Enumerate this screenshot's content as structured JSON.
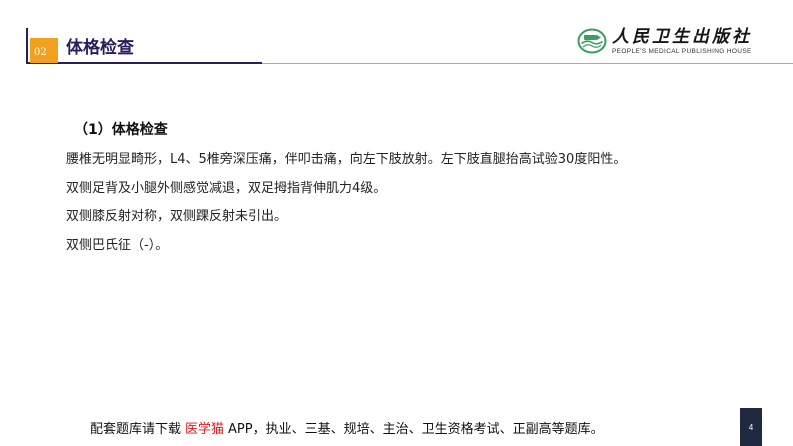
{
  "header": {
    "section_number": "02",
    "title": "体格检查"
  },
  "logo": {
    "emblem_icon": "publisher-emblem-icon",
    "name_cn": "人民卫生出版社",
    "name_en": "PEOPLE'S MEDICAL PUBLISHING HOUSE"
  },
  "content": {
    "heading": "（1）体格检查",
    "lines": [
      "腰椎无明显畸形，L4、5椎旁深压痛，伴叩击痛，向左下肢放射。左下肢直腿抬高试验30度阳性。",
      "双侧足背及小腿外侧感觉减退，双足拇指背伸肌力4级。",
      "双侧膝反射对称，双侧踝反射未引出。",
      "双侧巴氏征（-）。"
    ]
  },
  "footer": {
    "prefix": "配套题库请下载",
    "app_name": "医学猫",
    "suffix": "APP，执业、三基、规培、主治、卫生资格考试、正副高等题库。"
  },
  "slide_number": "4",
  "colors": {
    "primary": "#2b1d5c",
    "accent": "#f2a11f",
    "app_name": "#e0161b",
    "page_number_bg": "#1f2940",
    "logo_green": "#3a9c5e"
  }
}
